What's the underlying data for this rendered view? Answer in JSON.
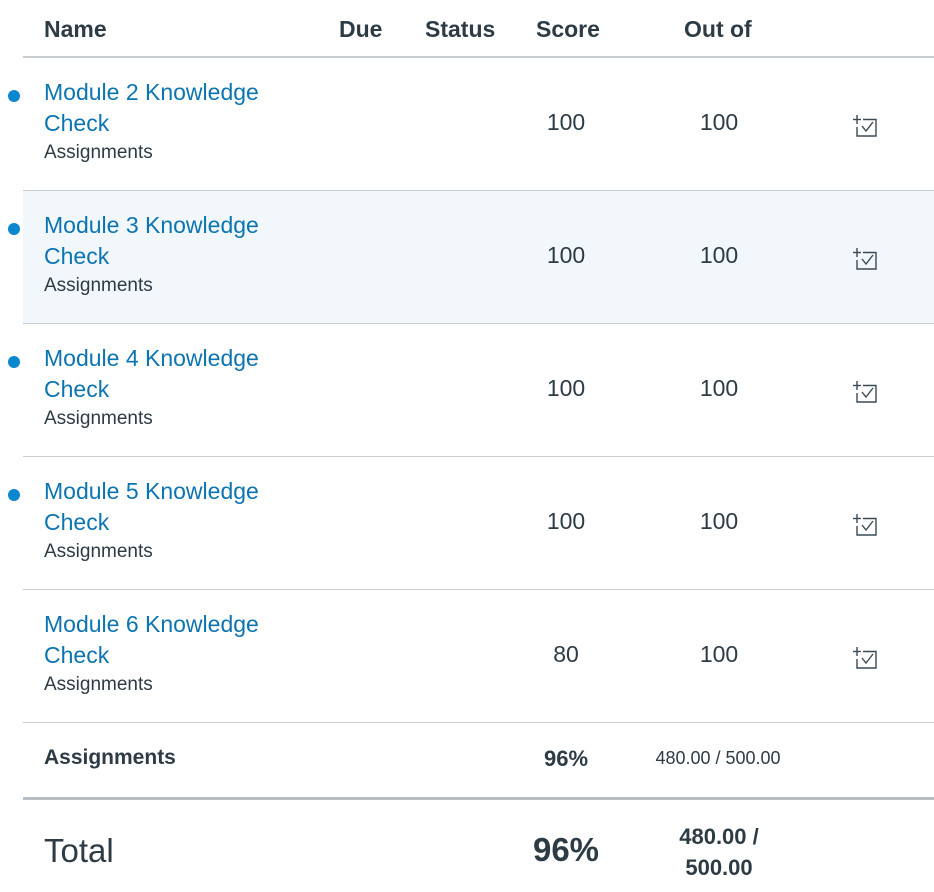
{
  "columns": {
    "name": "Name",
    "due": "Due",
    "status": "Status",
    "score": "Score",
    "out_of": "Out of"
  },
  "rows": [
    {
      "title": "Module 2 Knowledge Check",
      "category": "Assignments",
      "score": "100",
      "out_of": "100",
      "unread": true,
      "highlighted": false,
      "icon": "rubric-checklist-icon"
    },
    {
      "title": "Module 3 Knowledge Check",
      "category": "Assignments",
      "score": "100",
      "out_of": "100",
      "unread": true,
      "highlighted": true,
      "icon": "rubric-checklist-icon"
    },
    {
      "title": "Module 4 Knowledge Check",
      "category": "Assignments",
      "score": "100",
      "out_of": "100",
      "unread": true,
      "highlighted": false,
      "icon": "rubric-checklist-icon"
    },
    {
      "title": "Module 5 Knowledge Check",
      "category": "Assignments",
      "score": "100",
      "out_of": "100",
      "unread": true,
      "highlighted": false,
      "icon": "rubric-checklist-icon"
    },
    {
      "title": "Module 6 Knowledge Check",
      "category": "Assignments",
      "score": "80",
      "out_of": "100",
      "unread": false,
      "highlighted": false,
      "icon": "rubric-checklist-icon"
    }
  ],
  "group_total": {
    "label": "Assignments",
    "percent": "96%",
    "points": "480.00 / 500.00"
  },
  "final_total": {
    "label": "Total",
    "percent": "96%",
    "points": "480.00 / 500.00"
  },
  "colors": {
    "link": "#0b74b1",
    "unread_dot": "#0b87cf",
    "highlight_row": "#f1f7fb",
    "text": "#2d3b45",
    "divider": "#c7cdd1"
  }
}
